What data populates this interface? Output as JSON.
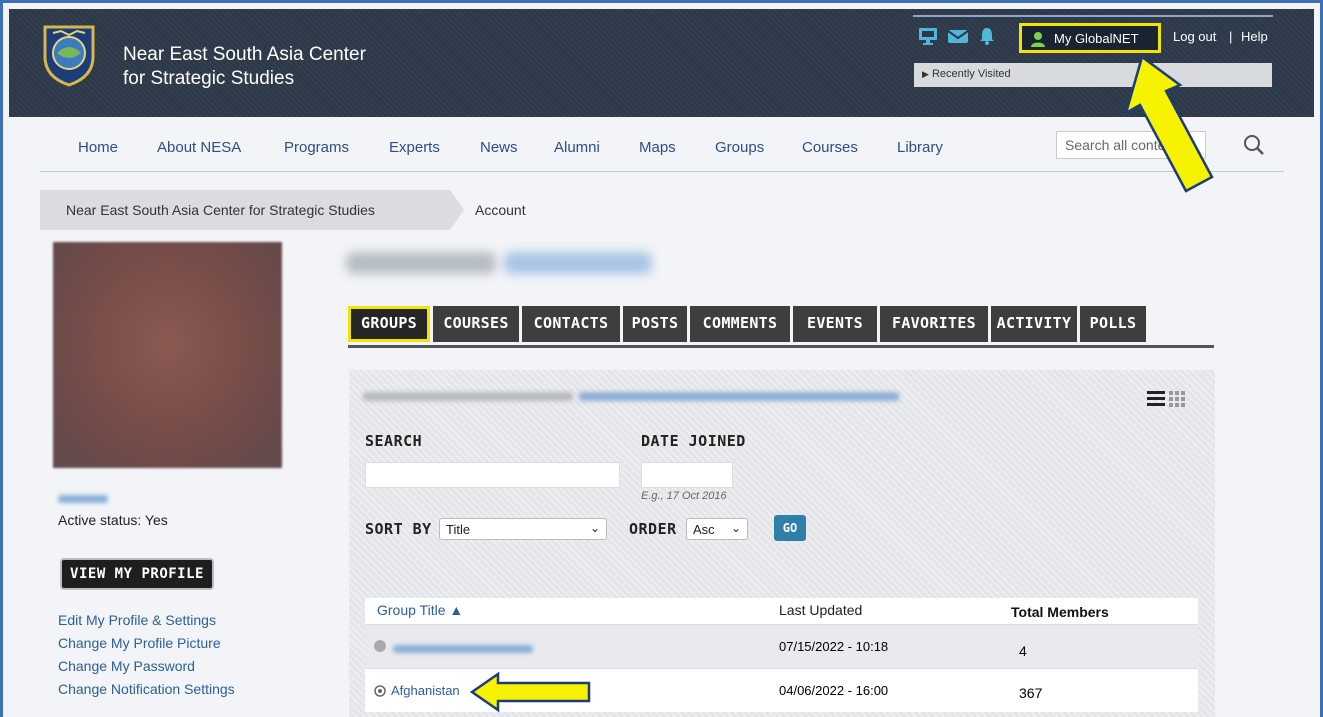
{
  "header": {
    "site_name_line1": "Near East South Asia Center",
    "site_name_line2": "for Strategic Studies",
    "my_globalnet_label": "My GlobalNET",
    "logout_label": "Log out",
    "separator": "|",
    "help_label": "Help",
    "recently_visited_label": "Recently Visited"
  },
  "nav": {
    "items": [
      "Home",
      "About NESA",
      "Programs",
      "Experts",
      "News",
      "Alumni",
      "Maps",
      "Groups",
      "Courses",
      "Library"
    ],
    "search_placeholder": "Search all content"
  },
  "breadcrumb": {
    "root": "Near East South Asia Center for Strategic Studies",
    "current": "Account"
  },
  "sidebar": {
    "active_status": "Active status: Yes",
    "view_profile_label": "VIEW MY PROFILE",
    "links": [
      "Edit My Profile & Settings",
      "Change My Profile Picture",
      "Change My Password",
      "Change Notification Settings"
    ]
  },
  "tabs": [
    "GROUPS",
    "COURSES",
    "CONTACTS",
    "POSTS",
    "COMMENTS",
    "EVENTS",
    "FAVORITES",
    "ACTIVITY",
    "POLLS"
  ],
  "filters": {
    "search_label": "SEARCH",
    "date_joined_label": "DATE JOINED",
    "date_hint": "E.g., 17 Oct 2016",
    "sort_by_label": "SORT BY",
    "sort_by_value": "Title",
    "order_label": "ORDER",
    "order_value": "Asc",
    "go_label": "GO"
  },
  "table": {
    "columns": [
      "Group Title ▲",
      "Last Updated",
      "Total Members"
    ],
    "rows": [
      {
        "title": "",
        "updated": "07/15/2022 - 10:18",
        "members": "4"
      },
      {
        "title": "Afghanistan",
        "updated": "04/06/2022 - 16:00",
        "members": "367"
      }
    ]
  },
  "colors": {
    "header_bg": "#2c3848",
    "highlight": "#f1e400",
    "link": "#2c5f94",
    "go_button": "#2f7fa8"
  }
}
